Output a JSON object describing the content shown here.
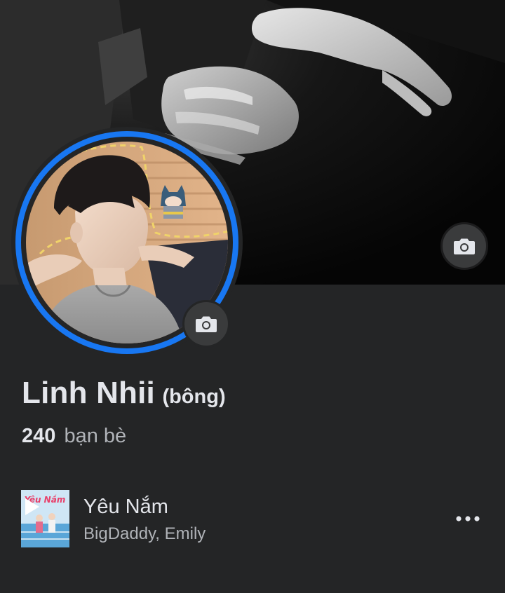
{
  "profile": {
    "name": "Linh Nhii",
    "alternate_name": "(bông)",
    "friends_count": "240",
    "friends_label": "bạn bè"
  },
  "music": {
    "song_title": "Yêu Nắm",
    "artists": "BigDaddy, Emily",
    "album_art_text": "Yêu Nắm"
  },
  "icons": {
    "cover_camera": "camera-icon",
    "avatar_camera": "camera-icon",
    "play": "play-icon",
    "more": "more-horizontal-icon"
  },
  "colors": {
    "background": "#242526",
    "avatar_ring": "#1877f2",
    "primary_text": "#e4e6eb",
    "secondary_text": "#b0b3b8",
    "icon_button": "#3a3b3c"
  }
}
